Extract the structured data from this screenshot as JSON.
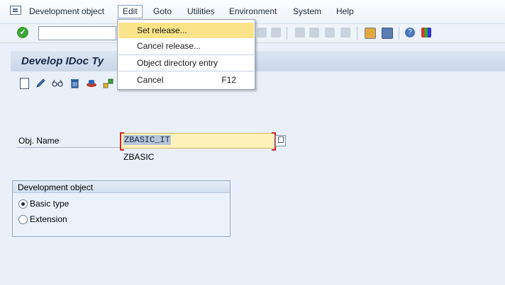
{
  "menubar": {
    "items": [
      "Development object",
      "Edit",
      "Goto",
      "Utilities",
      "Environment",
      "System",
      "Help"
    ]
  },
  "edit_menu": {
    "items": [
      {
        "label": "Set release...",
        "shortcut": ""
      },
      {
        "label": "Cancel release...",
        "shortcut": ""
      },
      {
        "label": "Object directory entry",
        "shortcut": ""
      },
      {
        "label": "Cancel",
        "shortcut": "F12"
      }
    ]
  },
  "title": "Develop IDoc Ty",
  "form": {
    "obj_name_label": "Obj. Name",
    "obj_name_value": "ZBASIC_IT",
    "description": "ZBASIC"
  },
  "dev_object": {
    "title": "Development object",
    "options": [
      "Basic type",
      "Extension"
    ],
    "selected": "Basic type"
  },
  "colors": {
    "highlight": "#fbe38a",
    "input_bg": "#fdf3ba",
    "required_marker": "#d6242c"
  }
}
